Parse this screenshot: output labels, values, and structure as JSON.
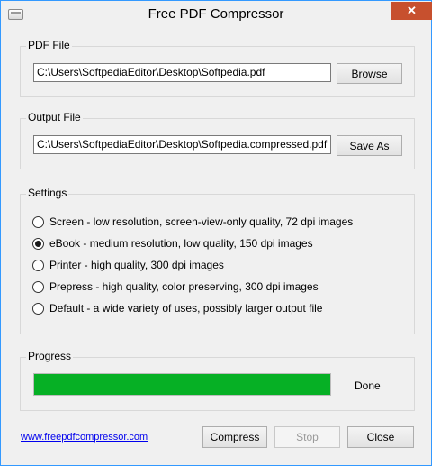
{
  "window": {
    "title": "Free PDF Compressor",
    "close_glyph": "✕"
  },
  "pdf_file": {
    "label": "PDF File",
    "value": "C:\\Users\\SoftpediaEditor\\Desktop\\Softpedia.pdf",
    "browse_label": "Browse"
  },
  "output_file": {
    "label": "Output File",
    "value": "C:\\Users\\SoftpediaEditor\\Desktop\\Softpedia.compressed.pdf",
    "save_as_label": "Save As"
  },
  "settings": {
    "label": "Settings",
    "options": [
      {
        "label": "Screen - low resolution, screen-view-only quality, 72 dpi images",
        "checked": false
      },
      {
        "label": "eBook - medium resolution, low quality, 150 dpi images",
        "checked": true
      },
      {
        "label": "Printer - high quality, 300 dpi images",
        "checked": false
      },
      {
        "label": "Prepress - high quality, color preserving, 300 dpi images",
        "checked": false
      },
      {
        "label": "Default - a wide variety of uses, possibly larger output file",
        "checked": false
      }
    ]
  },
  "progress": {
    "label": "Progress",
    "percent": 100,
    "status": "Done"
  },
  "footer": {
    "link": "www.freepdfcompressor.com",
    "compress_label": "Compress",
    "stop_label": "Stop",
    "close_label": "Close"
  },
  "colors": {
    "progress_fill": "#06b025",
    "close_button": "#c7502e",
    "link": "#0000ee"
  }
}
